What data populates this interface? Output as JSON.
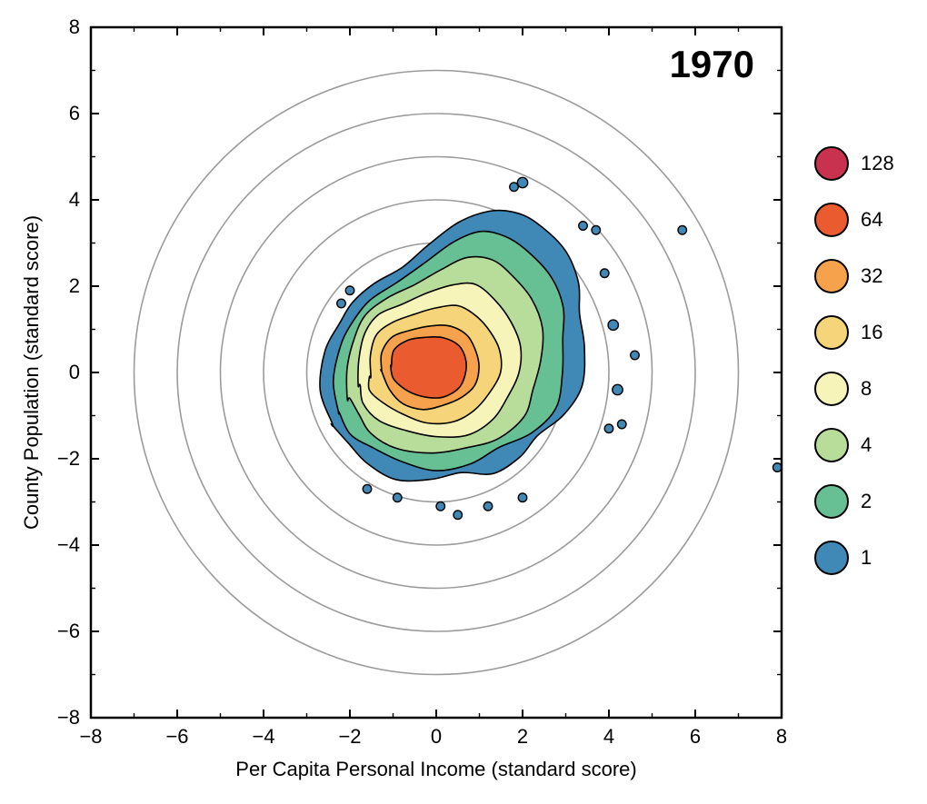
{
  "chart_data": {
    "type": "heatmap",
    "title": "",
    "xlabel": "Per Capita Personal Income (standard score)",
    "ylabel": "County Population (standard score)",
    "annotation": "1970",
    "xlim": [
      -8,
      8
    ],
    "ylim": [
      -8,
      8
    ],
    "x_ticks": [
      -8,
      -6,
      -4,
      -2,
      0,
      2,
      4,
      6,
      8
    ],
    "y_ticks": [
      -8,
      -6,
      -4,
      -2,
      0,
      2,
      4,
      6,
      8
    ],
    "grid": false,
    "reference_circles_radii": [
      1,
      2,
      3,
      4,
      5,
      6,
      7
    ],
    "legend_position": "right",
    "legend": [
      {
        "label": "128",
        "color": "#c8324f"
      },
      {
        "label": "64",
        "color": "#ea5b30"
      },
      {
        "label": "32",
        "color": "#f6a24c"
      },
      {
        "label": "16",
        "color": "#f6d57a"
      },
      {
        "label": "8",
        "color": "#f6f4b8"
      },
      {
        "label": "4",
        "color": "#b8dd9b"
      },
      {
        "label": "2",
        "color": "#67bf94"
      },
      {
        "label": "1",
        "color": "#4089b6"
      }
    ],
    "density_contours": [
      {
        "level": 1,
        "color": "#4089b6",
        "points": [
          [
            -2.4,
            -1.2
          ],
          [
            -2.6,
            -0.4
          ],
          [
            -2.6,
            0.5
          ],
          [
            -2.3,
            1.2
          ],
          [
            -1.9,
            1.6
          ],
          [
            -1.4,
            2.0
          ],
          [
            -0.8,
            2.5
          ],
          [
            -0.2,
            3.0
          ],
          [
            0.5,
            3.4
          ],
          [
            1.2,
            3.7
          ],
          [
            1.8,
            3.8
          ],
          [
            2.3,
            3.5
          ],
          [
            2.9,
            2.8
          ],
          [
            3.3,
            2.1
          ],
          [
            3.4,
            1.4
          ],
          [
            3.4,
            0.6
          ],
          [
            3.3,
            -0.3
          ],
          [
            3.0,
            -1.0
          ],
          [
            2.4,
            -1.5
          ],
          [
            1.9,
            -1.9
          ],
          [
            1.3,
            -2.3
          ],
          [
            0.6,
            -2.4
          ],
          [
            -0.1,
            -2.5
          ],
          [
            -0.9,
            -2.4
          ],
          [
            -1.6,
            -2.1
          ],
          [
            -2.1,
            -1.7
          ],
          [
            -2.4,
            -1.2
          ]
        ]
      },
      {
        "level": 2,
        "color": "#67bf94",
        "points": [
          [
            -2.2,
            -0.9
          ],
          [
            -2.35,
            -0.2
          ],
          [
            -2.3,
            0.6
          ],
          [
            -2.0,
            1.1
          ],
          [
            -1.5,
            1.6
          ],
          [
            -0.9,
            2.1
          ],
          [
            -0.3,
            2.6
          ],
          [
            0.4,
            3.0
          ],
          [
            1.0,
            3.2
          ],
          [
            1.6,
            3.2
          ],
          [
            2.1,
            2.9
          ],
          [
            2.6,
            2.2
          ],
          [
            2.9,
            1.5
          ],
          [
            3.0,
            0.8
          ],
          [
            2.95,
            0.0
          ],
          [
            2.7,
            -0.8
          ],
          [
            2.2,
            -1.4
          ],
          [
            1.5,
            -1.8
          ],
          [
            0.8,
            -2.1
          ],
          [
            0.0,
            -2.2
          ],
          [
            -0.8,
            -2.1
          ],
          [
            -1.5,
            -1.8
          ],
          [
            -1.95,
            -1.4
          ],
          [
            -2.2,
            -0.9
          ]
        ]
      },
      {
        "level": 4,
        "color": "#b8dd9b",
        "points": [
          [
            -2.0,
            -0.6
          ],
          [
            -2.1,
            0.1
          ],
          [
            -1.95,
            0.8
          ],
          [
            -1.6,
            1.3
          ],
          [
            -1.1,
            1.7
          ],
          [
            -0.5,
            2.1
          ],
          [
            0.1,
            2.4
          ],
          [
            0.7,
            2.6
          ],
          [
            1.3,
            2.6
          ],
          [
            1.8,
            2.3
          ],
          [
            2.2,
            1.7
          ],
          [
            2.4,
            1.0
          ],
          [
            2.45,
            0.3
          ],
          [
            2.3,
            -0.4
          ],
          [
            2.0,
            -1.0
          ],
          [
            1.4,
            -1.5
          ],
          [
            0.7,
            -1.8
          ],
          [
            -0.1,
            -1.9
          ],
          [
            -0.9,
            -1.7
          ],
          [
            -1.5,
            -1.4
          ],
          [
            -1.85,
            -1.0
          ],
          [
            -2.0,
            -0.6
          ]
        ]
      },
      {
        "level": 8,
        "color": "#f6f4b8",
        "points": [
          [
            -1.8,
            -0.3
          ],
          [
            -1.85,
            0.3
          ],
          [
            -1.65,
            0.9
          ],
          [
            -1.3,
            1.3
          ],
          [
            -0.8,
            1.6
          ],
          [
            -0.2,
            1.9
          ],
          [
            0.4,
            2.0
          ],
          [
            0.9,
            2.0
          ],
          [
            1.4,
            1.7
          ],
          [
            1.75,
            1.2
          ],
          [
            1.9,
            0.6
          ],
          [
            1.9,
            0.0
          ],
          [
            1.7,
            -0.6
          ],
          [
            1.3,
            -1.1
          ],
          [
            0.7,
            -1.4
          ],
          [
            0.0,
            -1.5
          ],
          [
            -0.7,
            -1.4
          ],
          [
            -1.3,
            -1.1
          ],
          [
            -1.65,
            -0.7
          ],
          [
            -1.8,
            -0.3
          ]
        ]
      },
      {
        "level": 16,
        "color": "#f6d57a",
        "points": [
          [
            -1.55,
            -0.1
          ],
          [
            -1.55,
            0.4
          ],
          [
            -1.35,
            0.85
          ],
          [
            -1.0,
            1.15
          ],
          [
            -0.5,
            1.4
          ],
          [
            0.0,
            1.5
          ],
          [
            0.5,
            1.5
          ],
          [
            0.95,
            1.3
          ],
          [
            1.3,
            0.95
          ],
          [
            1.45,
            0.5
          ],
          [
            1.45,
            0.0
          ],
          [
            1.25,
            -0.5
          ],
          [
            0.9,
            -0.9
          ],
          [
            0.4,
            -1.1
          ],
          [
            -0.2,
            -1.15
          ],
          [
            -0.8,
            -1.0
          ],
          [
            -1.25,
            -0.7
          ],
          [
            -1.5,
            -0.4
          ],
          [
            -1.55,
            -0.1
          ]
        ]
      },
      {
        "level": 32,
        "color": "#f6a24c",
        "points": [
          [
            -1.3,
            0.05
          ],
          [
            -1.25,
            0.45
          ],
          [
            -1.0,
            0.8
          ],
          [
            -0.6,
            1.0
          ],
          [
            -0.15,
            1.1
          ],
          [
            0.3,
            1.05
          ],
          [
            0.7,
            0.85
          ],
          [
            0.95,
            0.5
          ],
          [
            1.0,
            0.1
          ],
          [
            0.85,
            -0.3
          ],
          [
            0.55,
            -0.6
          ],
          [
            0.15,
            -0.8
          ],
          [
            -0.3,
            -0.85
          ],
          [
            -0.75,
            -0.7
          ],
          [
            -1.1,
            -0.4
          ],
          [
            -1.3,
            0.05
          ]
        ]
      },
      {
        "level": 64,
        "color": "#ea5b30",
        "points": [
          [
            -1.05,
            0.15
          ],
          [
            -0.95,
            0.5
          ],
          [
            -0.65,
            0.75
          ],
          [
            -0.25,
            0.85
          ],
          [
            0.15,
            0.8
          ],
          [
            0.5,
            0.6
          ],
          [
            0.7,
            0.3
          ],
          [
            0.7,
            -0.05
          ],
          [
            0.5,
            -0.35
          ],
          [
            0.15,
            -0.55
          ],
          [
            -0.25,
            -0.6
          ],
          [
            -0.65,
            -0.45
          ],
          [
            -0.95,
            -0.15
          ],
          [
            -1.05,
            0.15
          ]
        ]
      }
    ],
    "outlier_blobs": [
      {
        "x": 2.0,
        "y": 4.4,
        "r": 0.12
      },
      {
        "x": 1.8,
        "y": 4.3,
        "r": 0.1
      },
      {
        "x": 3.4,
        "y": 3.4,
        "r": 0.1
      },
      {
        "x": 3.7,
        "y": 3.3,
        "r": 0.1
      },
      {
        "x": 5.7,
        "y": 3.3,
        "r": 0.1
      },
      {
        "x": 3.9,
        "y": 2.3,
        "r": 0.1
      },
      {
        "x": 4.1,
        "y": 1.1,
        "r": 0.12
      },
      {
        "x": 4.6,
        "y": 0.4,
        "r": 0.1
      },
      {
        "x": 4.2,
        "y": -0.4,
        "r": 0.12
      },
      {
        "x": 4.0,
        "y": -1.3,
        "r": 0.1
      },
      {
        "x": 4.3,
        "y": -1.2,
        "r": 0.1
      },
      {
        "x": 7.9,
        "y": -2.2,
        "r": 0.1
      },
      {
        "x": 2.0,
        "y": -2.9,
        "r": 0.1
      },
      {
        "x": 1.2,
        "y": -3.1,
        "r": 0.1
      },
      {
        "x": 0.5,
        "y": -3.3,
        "r": 0.1
      },
      {
        "x": 0.1,
        "y": -3.1,
        "r": 0.1
      },
      {
        "x": -0.9,
        "y": -2.9,
        "r": 0.1
      },
      {
        "x": -1.6,
        "y": -2.7,
        "r": 0.1
      },
      {
        "x": -2.2,
        "y": 1.6,
        "r": 0.1
      },
      {
        "x": -2.0,
        "y": 1.9,
        "r": 0.1
      }
    ]
  }
}
